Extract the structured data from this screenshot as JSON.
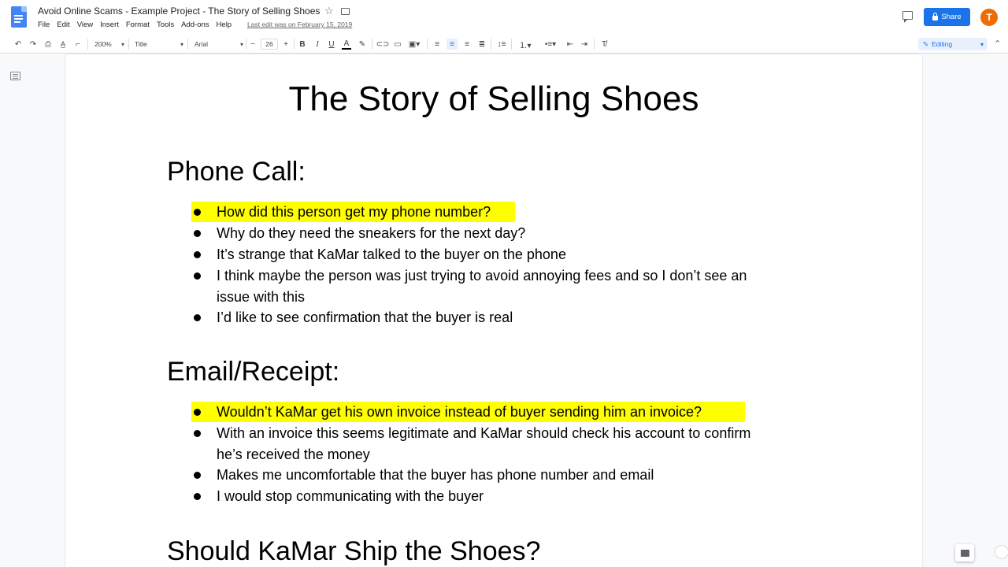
{
  "window": {
    "doc_title": "Avoid Online Scams - Example Project - The Story of Selling Shoes",
    "last_edit": "Last edit was on February 15, 2019"
  },
  "menu": [
    "File",
    "Edit",
    "View",
    "Insert",
    "Format",
    "Tools",
    "Add-ons",
    "Help"
  ],
  "header": {
    "share_label": "Share",
    "avatar_letter": "T",
    "accent_color": "#1a73e8",
    "avatar_color": "#ef6c00"
  },
  "toolbar": {
    "zoom": "200%",
    "style": "Title",
    "font": "Arial",
    "font_size": "26",
    "mode": "Editing"
  },
  "document": {
    "title": "The Story of Selling Shoes",
    "sections": [
      {
        "heading": "Phone Call:",
        "bullets": [
          {
            "text": "How did this person get my phone number?",
            "highlight": true
          },
          {
            "text": "Why do they need the sneakers for the next day?",
            "highlight": false
          },
          {
            "text": "It’s strange that KaMar talked to the buyer on the phone",
            "highlight": false
          },
          {
            "text": "I think maybe the person was just trying to avoid annoying fees and so I don’t see an",
            "text2": "issue with this",
            "highlight": false
          },
          {
            "text": "I’d like to see confirmation that the buyer is real",
            "highlight": false
          }
        ]
      },
      {
        "heading": "Email/Receipt:",
        "bullets": [
          {
            "text": "Wouldn’t KaMar get his own invoice instead of buyer sending him an invoice?",
            "highlight": true
          },
          {
            "text": "With an invoice this seems legitimate and KaMar should check his account to confirm",
            "text2": "he’s received the money",
            "highlight": false
          },
          {
            "text": "Makes me uncomfortable that the buyer has phone number and email",
            "highlight": false
          },
          {
            "text": "I would stop communicating with the buyer",
            "highlight": false
          }
        ]
      },
      {
        "heading": "Should KaMar Ship the Shoes?"
      }
    ],
    "highlight_color": "#ffff00"
  }
}
